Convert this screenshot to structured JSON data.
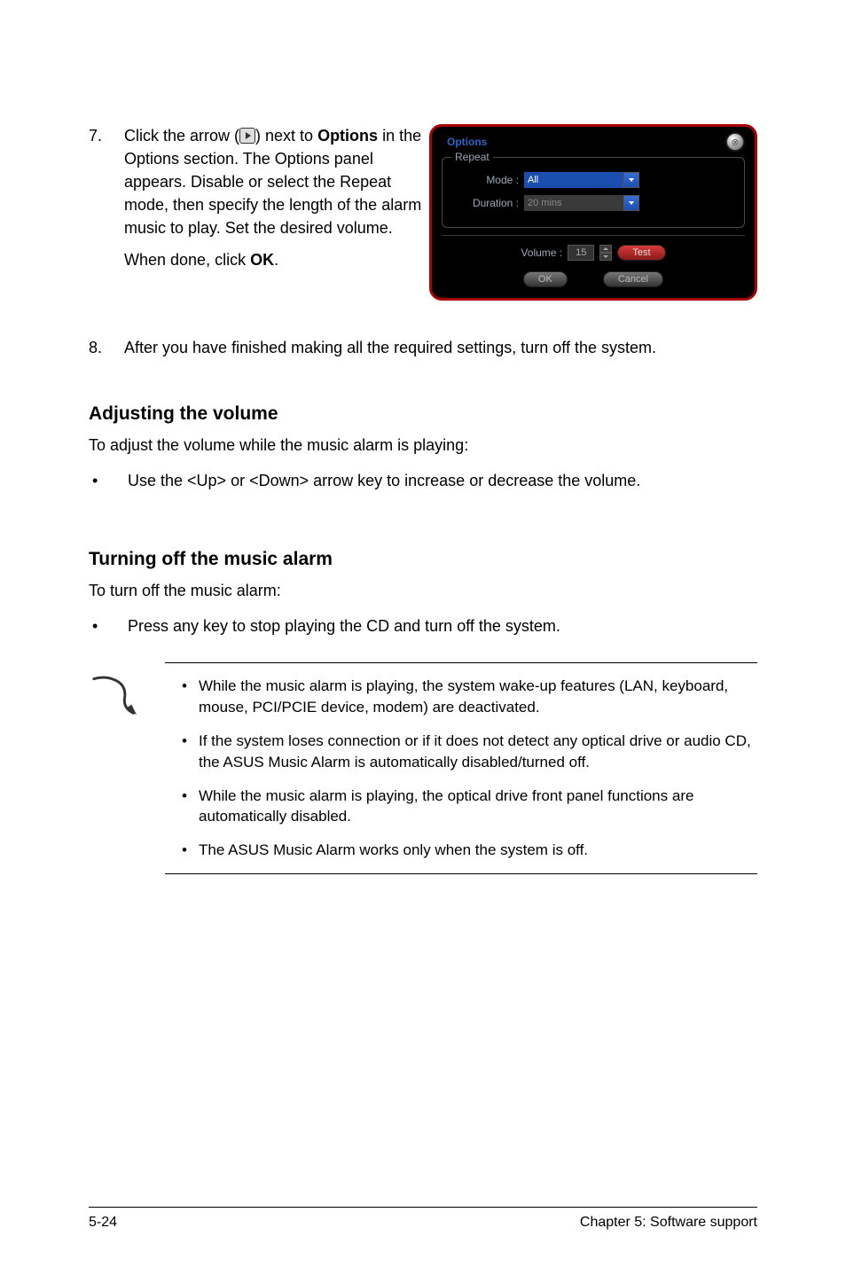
{
  "step7": {
    "num": "7.",
    "line1a": "Click the arrow (",
    "line1b": ") next to ",
    "options_bold": "Options",
    "rest": " in the Options section. The Options panel appears. Disable or select the Repeat mode, then specify the length of the alarm music to play. Set the desired volume.",
    "done_a": "When done, click ",
    "done_bold": "OK",
    "done_b": "."
  },
  "panel": {
    "title": "Options",
    "legend": "Repeat",
    "mode_label": "Mode :",
    "mode_value": "All",
    "duration_label": "Duration :",
    "duration_value": "20 mins",
    "volume_label": "Volume :",
    "volume_value": "15",
    "test": "Test",
    "ok": "OK",
    "cancel": "Cancel"
  },
  "step8": {
    "num": "8.",
    "text": "After you have finished making all the required settings, turn off the system."
  },
  "adjusting": {
    "heading": "Adjusting the volume",
    "intro": "To adjust the volume while the music alarm is playing:",
    "bullet": "Use the  <Up> or <Down> arrow key to increase or decrease the volume."
  },
  "turnoff": {
    "heading": "Turning off the music alarm",
    "intro": "To turn off the music alarm:",
    "bullet": "Press any key to stop playing the CD and turn off the system."
  },
  "notes": {
    "n1": "While the music alarm is playing, the system wake-up features (LAN, keyboard, mouse, PCI/PCIE device, modem) are deactivated.",
    "n2": "If the system loses connection or if it does not detect any optical drive or audio CD, the ASUS Music Alarm is automatically disabled/turned off.",
    "n3": "While the music alarm is playing, the optical drive front panel functions are automatically disabled.",
    "n4": "The ASUS Music Alarm works only when the system is off."
  },
  "footer": {
    "left": "5-24",
    "right": "Chapter 5: Software support"
  }
}
